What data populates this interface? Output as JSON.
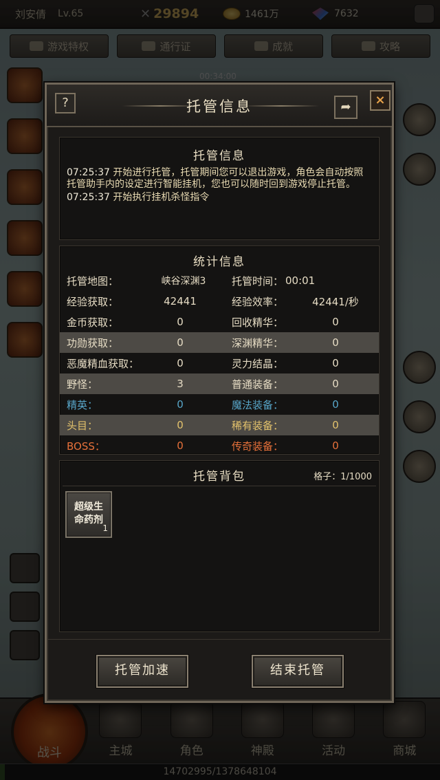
{
  "topbar": {
    "player_name": "刘安倩",
    "level": "Lv.65",
    "power": "29894",
    "gold": "1461万",
    "gems": "7632"
  },
  "nav": {
    "items": [
      {
        "label": "游戏特权"
      },
      {
        "label": "通行证"
      },
      {
        "label": "成就"
      },
      {
        "label": "攻略"
      }
    ]
  },
  "timer": "00:34:00",
  "modal": {
    "title": "托管信息",
    "help_label": "?",
    "close_label": "×",
    "share_label": "➦",
    "log": {
      "title": "托管信息",
      "lines": [
        {
          "time": "07:25:37",
          "text": " 开始进行托管，托管期间您可以退出游戏，角色会自动按照托管助手内的设定进行智能挂机，您也可以随时回到游戏停止托管。"
        },
        {
          "time": "07:25:37",
          "text": " 开始执行挂机杀怪指令"
        }
      ]
    },
    "stats": {
      "title": "统计信息",
      "rows": [
        {
          "label": "托管地图：",
          "value": "峡谷深渊3",
          "label2": "托管时间：",
          "value2": "00:01"
        },
        {
          "label": "经验获取：",
          "value": "42441",
          "label2": "经验效率：",
          "value2": "42441/秒"
        },
        {
          "label": "金币获取：",
          "value": "0",
          "label2": "回收精华：",
          "value2": "0"
        },
        {
          "label": "功勋获取：",
          "value": "0",
          "label2": "深渊精华：",
          "value2": "0"
        },
        {
          "label": "恶魔精血获取：",
          "value": "0",
          "label2": "灵力结晶：",
          "value2": "0"
        },
        {
          "label": "野怪：",
          "value": "3",
          "label2": "普通装备：",
          "value2": "0"
        },
        {
          "label": "精英：",
          "value": "0",
          "label2": "魔法装备：",
          "value2": "0"
        },
        {
          "label": "头目：",
          "value": "0",
          "label2": "稀有装备：",
          "value2": "0"
        },
        {
          "label": "BOSS：",
          "value": "0",
          "label2": "传奇装备：",
          "value2": "0"
        }
      ]
    },
    "bag": {
      "title": "托管背包",
      "capacity": "格子：1/1000",
      "items": [
        {
          "name": "超级生命药剂",
          "count": "1"
        }
      ]
    },
    "buttons": {
      "speedup": "托管加速",
      "end": "结束托管"
    }
  },
  "bottom": {
    "fight_label": "战斗",
    "tabs": [
      {
        "label": "主城"
      },
      {
        "label": "角色"
      },
      {
        "label": "神殿"
      },
      {
        "label": "活动"
      },
      {
        "label": "商城"
      }
    ],
    "exp": "14702995/1378648104",
    "exp_fraction": 0.0107
  },
  "colors": {
    "elite": "#58a6c9",
    "boss": "#e7713a",
    "power": "#e8c067"
  }
}
